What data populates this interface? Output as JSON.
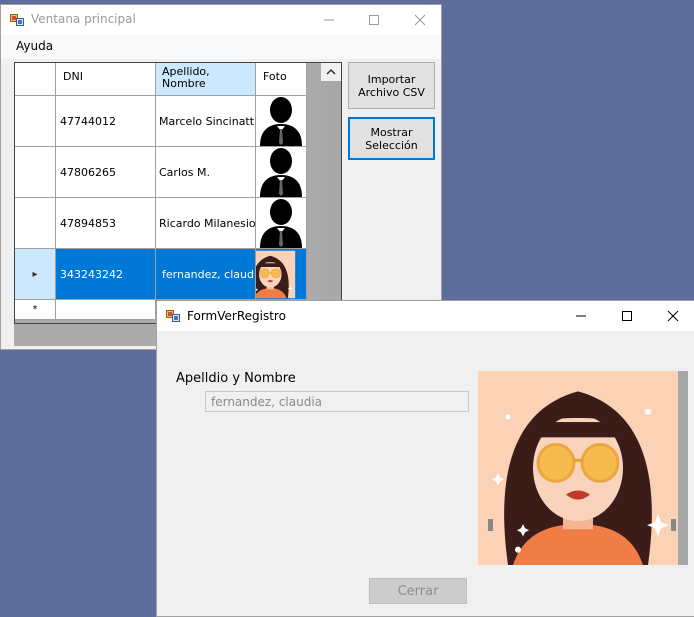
{
  "main_window": {
    "title": "Ventana principal",
    "menu": [
      "Ayuda"
    ],
    "grid": {
      "columns": [
        "DNI",
        "Apellido, Nombre",
        "Foto"
      ],
      "rows": [
        {
          "dni": "47744012",
          "name": "Marcelo Sincinatti",
          "photo": "silhouette-icon"
        },
        {
          "dni": "47806265",
          "name": "Carlos M.",
          "photo": "silhouette-icon"
        },
        {
          "dni": "47894853",
          "name": "Ricardo Milanesio",
          "photo": "silhouette-icon"
        },
        {
          "dni": "343243242",
          "name": "fernandez, claudia",
          "photo": "woman-portrait",
          "selected": true
        }
      ],
      "current_row_marker": "▸",
      "new_row_marker": "*"
    },
    "buttons": {
      "import": "Importar Archivo CSV",
      "show": "Mostrar Selección"
    }
  },
  "register_window": {
    "title": "FormVerRegistro",
    "name_label": "Apelldio y Nombre",
    "name_value": "fernandez, claudia",
    "close_label": "Cerrar",
    "photo": "woman-portrait"
  },
  "colors": {
    "selection": "#0078d7",
    "desktop": "#5e6d9c",
    "photo_background": "#fbd2b5"
  }
}
